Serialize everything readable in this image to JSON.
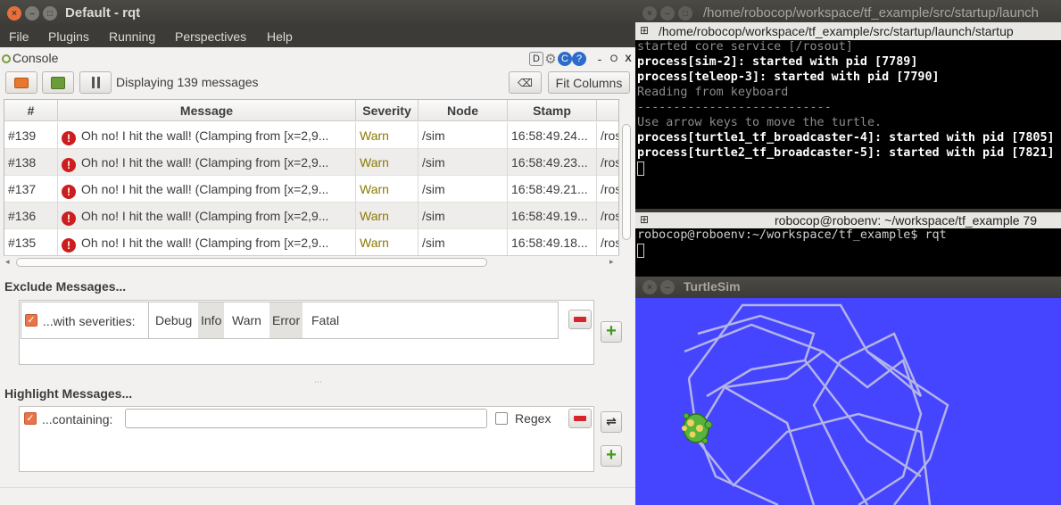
{
  "rqt": {
    "title": "Default - rqt",
    "menu": [
      "File",
      "Plugins",
      "Running",
      "Perspectives",
      "Help"
    ],
    "console_label": "Console",
    "toolbar": {
      "status": "Displaying 139 messages",
      "fit_columns": "Fit Columns"
    },
    "header_icons": {
      "d_label": "D",
      "min_label": "-",
      "close_label": "O",
      "x_label": "X"
    },
    "table": {
      "columns": [
        "#",
        "Message",
        "Severity",
        "Node",
        "Stamp"
      ],
      "rows": [
        {
          "id": "#139",
          "message": "Oh no! I hit the wall! (Clamping from [x=2,9...",
          "severity": "Warn",
          "node": "/sim",
          "stamp": "16:58:49.24...",
          "topics": "/ros"
        },
        {
          "id": "#138",
          "message": "Oh no! I hit the wall! (Clamping from [x=2,9...",
          "severity": "Warn",
          "node": "/sim",
          "stamp": "16:58:49.23...",
          "topics": "/ros"
        },
        {
          "id": "#137",
          "message": "Oh no! I hit the wall! (Clamping from [x=2,9...",
          "severity": "Warn",
          "node": "/sim",
          "stamp": "16:58:49.21...",
          "topics": "/ros"
        },
        {
          "id": "#136",
          "message": "Oh no! I hit the wall! (Clamping from [x=2,9...",
          "severity": "Warn",
          "node": "/sim",
          "stamp": "16:58:49.19...",
          "topics": "/ros"
        },
        {
          "id": "#135",
          "message": "Oh no! I hit the wall! (Clamping from [x=2,9...",
          "severity": "Warn",
          "node": "/sim",
          "stamp": "16:58:49.18...",
          "topics": "/ros"
        }
      ]
    },
    "exclude": {
      "title": "Exclude Messages...",
      "with_severities": "...with severities:",
      "severities": [
        "Debug",
        "Info",
        "Warn",
        "Error",
        "Fatal"
      ]
    },
    "highlight": {
      "title": "Highlight Messages...",
      "containing": "...containing:",
      "containing_value": "",
      "regex": "Regex"
    }
  },
  "terminal1": {
    "title": "/home/robocop/workspace/tf_example/src/startup/launch",
    "tab": "/home/robocop/workspace/tf_example/src/startup/launch/startup",
    "lines": [
      {
        "text": "started core service [/rosout]",
        "style": "g"
      },
      {
        "text": "process[sim-2]: started with pid [7789]",
        "style": "b"
      },
      {
        "text": "process[teleop-3]: started with pid [7790]",
        "style": "b"
      },
      {
        "text": "Reading from keyboard",
        "style": "g"
      },
      {
        "text": "---------------------------",
        "style": "g"
      },
      {
        "text": "Use arrow keys to move the turtle.",
        "style": "g"
      },
      {
        "text": "process[turtle1_tf_broadcaster-4]: started with pid [7805]",
        "style": "b"
      },
      {
        "text": "process[turtle2_tf_broadcaster-5]: started with pid [7821]",
        "style": "b"
      }
    ]
  },
  "terminal2": {
    "tab": "robocop@roboenv: ~/workspace/tf_example 79",
    "lines": [
      {
        "text": "robocop@roboenv:~/workspace/tf_example$ rqt",
        "style": ""
      }
    ]
  },
  "turtlesim": {
    "title": "TurtleSim",
    "background": "#4545ff",
    "trail_color": "#b3b3e6"
  }
}
